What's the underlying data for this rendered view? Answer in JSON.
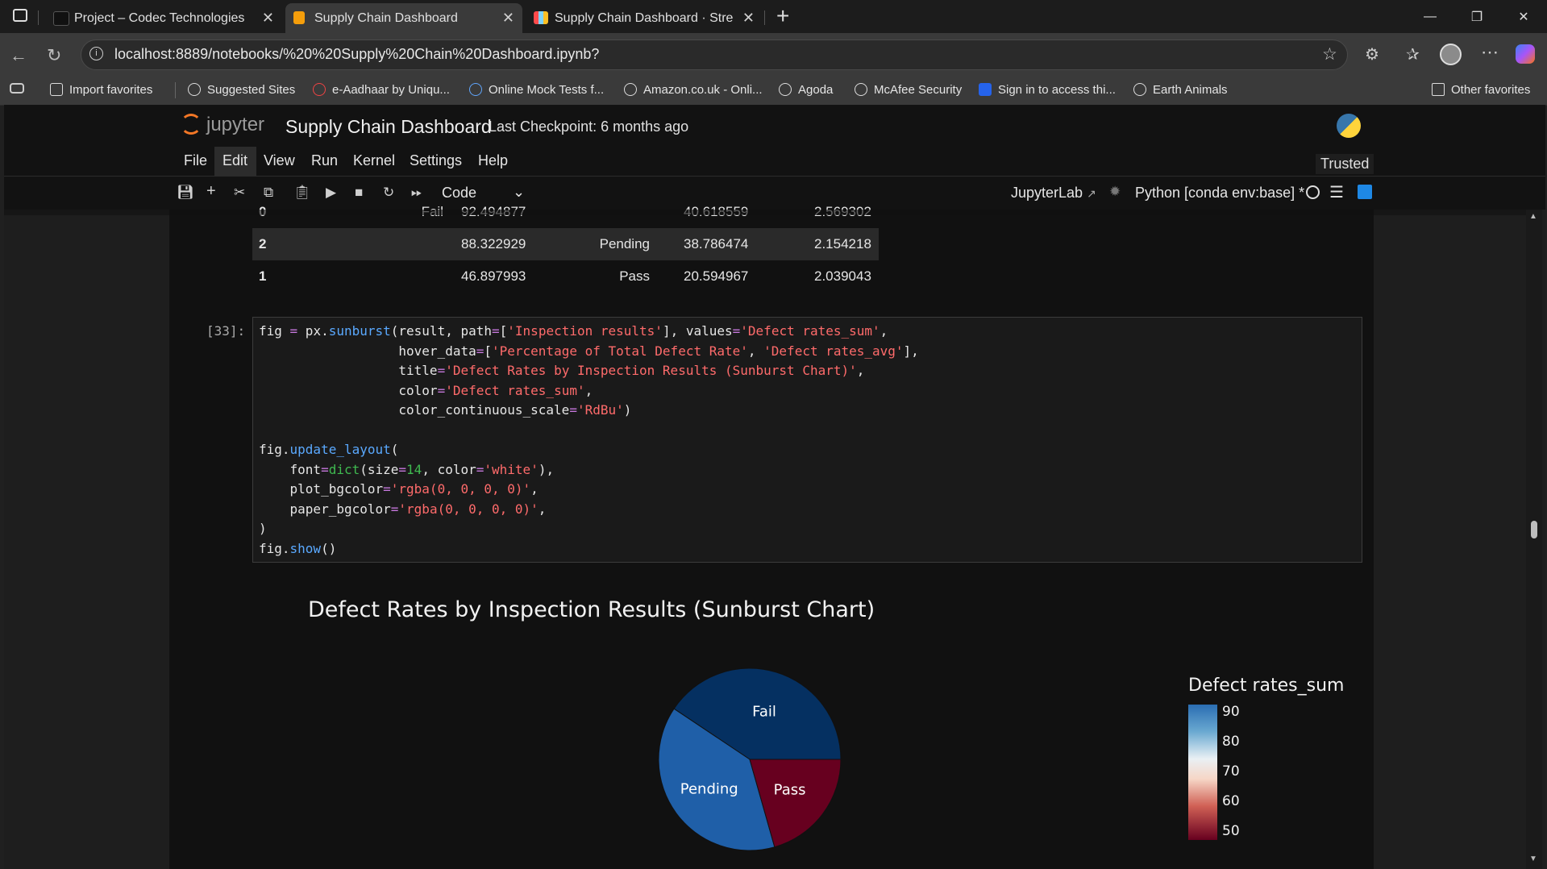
{
  "browser": {
    "tabs": [
      {
        "title": "Project – Codec Technologies",
        "active": false,
        "icon": "codec-icon"
      },
      {
        "title": "Supply Chain Dashboard",
        "active": true,
        "icon": "jupyter-book-icon"
      },
      {
        "title": "Supply Chain Dashboard · Stream",
        "active": false,
        "icon": "streamlit-icon"
      }
    ],
    "url": "localhost:8889/notebooks/%20%20Supply%20Chain%20Dashboard.ipynb?",
    "favorites": [
      {
        "label": "Import favorites",
        "icon": "import-icon"
      },
      {
        "label": "Suggested Sites",
        "icon": "globe-icon"
      },
      {
        "label": "e-Aadhaar by Uniqu...",
        "icon": "aadhaar-icon"
      },
      {
        "label": "Online Mock Tests f...",
        "icon": "mock-test-icon"
      },
      {
        "label": "Amazon.co.uk - Onli...",
        "icon": "globe-icon"
      },
      {
        "label": "Agoda",
        "icon": "globe-icon"
      },
      {
        "label": "McAfee Security",
        "icon": "globe-icon"
      },
      {
        "label": "Sign in to access thi...",
        "icon": "s-icon"
      },
      {
        "label": "Earth Animals",
        "icon": "globe-icon"
      }
    ],
    "other_favorites": "Other favorites"
  },
  "jupyter": {
    "logo_text": "jupyter",
    "notebook_title": "Supply Chain Dashboard",
    "checkpoint": "Last Checkpoint: 6 months ago",
    "menu": [
      "File",
      "Edit",
      "View",
      "Run",
      "Kernel",
      "Settings",
      "Help"
    ],
    "trusted": "Trusted",
    "cell_type": "Code",
    "jupyterlab_link": "JupyterLab",
    "kernel": "Python [conda env:base] *"
  },
  "table": {
    "rows": [
      {
        "index": "0",
        "result": "Fail",
        "sum": "92.494877",
        "pct": "40.618559",
        "avg": "2.569302"
      },
      {
        "index": "2",
        "result": "Pending",
        "sum": "88.322929",
        "pct": "38.786474",
        "avg": "2.154218"
      },
      {
        "index": "1",
        "result": "Pass",
        "sum": "46.897993",
        "pct": "20.594967",
        "avg": "2.039043"
      }
    ]
  },
  "cell": {
    "prompt": "[33]:"
  },
  "chart_data": {
    "type": "pie",
    "title": "Defect Rates by Inspection Results (Sunburst Chart)",
    "labels": [
      "Fail",
      "Pending",
      "Pass"
    ],
    "values": [
      92.494877,
      88.322929,
      46.897993
    ],
    "colors": [
      "#053061",
      "#1f5fa8",
      "#67001f"
    ],
    "colorbar": {
      "title": "Defect rates_sum",
      "ticks": [
        "90",
        "80",
        "70",
        "60",
        "50"
      ],
      "range": [
        46.897993,
        92.494877
      ],
      "scale": "RdBu"
    }
  }
}
